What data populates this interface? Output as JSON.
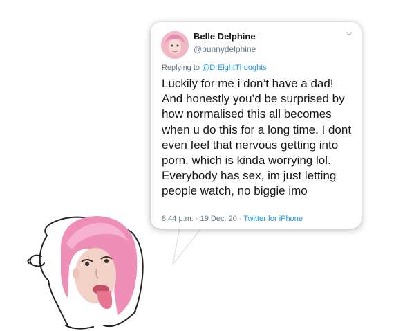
{
  "tweet": {
    "display_name": "Belle Delphine",
    "handle": "@bunnydelphine",
    "reply_prefix": "Replying to ",
    "reply_to": "@DrEightThoughts",
    "text": "Luckily for me i don’t have a dad! And honestly you’d be surprised by how normalised this all becomes when u do this for a long time. I dont even feel that nervous getting into porn, which is kinda worrying lol. Everybody has sex, im just letting people watch, no biggie imo",
    "time_date": "8:44 p.m. · 19 Dec. 20 · ",
    "source": "Twitter for iPhone"
  },
  "icons": {
    "menu": "chevron-down-icon",
    "avatar": "avatar",
    "face": "wojak-face-illustration"
  },
  "colors": {
    "link": "#1b95e0",
    "text": "#14171a",
    "muted": "#657786",
    "hair_pink": "#ef8fb8",
    "skin": "#f2d2c6"
  }
}
